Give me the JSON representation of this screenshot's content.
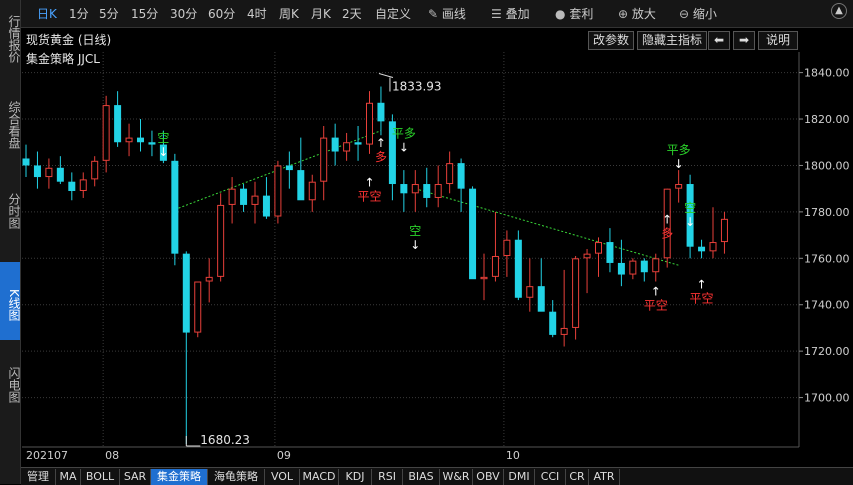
{
  "sidebar": {
    "items": [
      {
        "label": "行情报价",
        "active": false
      },
      {
        "label": "综合看盘",
        "active": false
      },
      {
        "label": "分时图",
        "active": false
      },
      {
        "label": "K线图",
        "active": true
      },
      {
        "label": "闪电图",
        "active": false
      }
    ]
  },
  "toolbar": {
    "periods": [
      "日K",
      "1分",
      "5分",
      "15分",
      "30分",
      "60分",
      "4时",
      "周K",
      "月K",
      "2天",
      "自定义"
    ],
    "active_period": "日K",
    "tools": [
      {
        "label": "画线",
        "icon": "pencil-icon"
      },
      {
        "label": "叠加",
        "icon": "layers-icon"
      },
      {
        "label": "套利",
        "icon": "moneybag-icon"
      },
      {
        "label": "放大",
        "icon": "zoom-in-icon"
      },
      {
        "label": "缩小",
        "icon": "zoom-out-icon"
      }
    ]
  },
  "chart_header": {
    "title": "现货黄金 (日线)",
    "strategy": "集金策略 JJCL"
  },
  "header_buttons": {
    "modify_params": "改参数",
    "hide_main_indicator": "隐藏主指标",
    "help": "说明"
  },
  "bottom_tabs": [
    "管理",
    "MA",
    "BOLL",
    "SAR",
    "集金策略",
    "海龟策略",
    "VOL",
    "MACD",
    "KDJ",
    "RSI",
    "BIAS",
    "W&R",
    "OBV",
    "DMI",
    "CCI",
    "CR",
    "ATR"
  ],
  "active_tab": "集金策略",
  "colors": {
    "up": "#e8403a",
    "down": "#22d3e6",
    "signal_green": "#2bd32b",
    "signal_red": "#ff3333",
    "trend_line": "#39d839",
    "accent": "#1f6fd0"
  },
  "chart_data": {
    "type": "candlestick",
    "y_axis": {
      "min": 1680,
      "max": 1845,
      "ticks": [
        1700,
        1720,
        1740,
        1760,
        1780,
        1800,
        1820,
        1840
      ]
    },
    "x_labels": [
      {
        "label": "202107",
        "index": 0
      },
      {
        "label": "08",
        "index": 7
      },
      {
        "label": "09",
        "index": 22
      },
      {
        "label": "10",
        "index": 42
      }
    ],
    "candles": [
      [
        1803,
        1809,
        1795,
        1800
      ],
      [
        1800,
        1806,
        1790,
        1795
      ],
      [
        1795,
        1803,
        1790,
        1799
      ],
      [
        1799,
        1804,
        1792,
        1793
      ],
      [
        1793,
        1797,
        1785,
        1789
      ],
      [
        1789,
        1797,
        1786,
        1794
      ],
      [
        1794,
        1804,
        1791,
        1802
      ],
      [
        1802,
        1830,
        1797,
        1826
      ],
      [
        1826,
        1832,
        1808,
        1810
      ],
      [
        1810,
        1818,
        1804,
        1812
      ],
      [
        1812,
        1820,
        1806,
        1810
      ],
      [
        1810,
        1815,
        1804,
        1809
      ],
      [
        1809,
        1815,
        1801,
        1802
      ],
      [
        1802,
        1805,
        1757,
        1762
      ],
      [
        1762,
        1763,
        1680,
        1728
      ],
      [
        1728,
        1749,
        1726,
        1750
      ],
      [
        1750,
        1760,
        1741,
        1752
      ],
      [
        1752,
        1788,
        1750,
        1783
      ],
      [
        1783,
        1795,
        1775,
        1790
      ],
      [
        1790,
        1792,
        1780,
        1783
      ],
      [
        1783,
        1793,
        1775,
        1787
      ],
      [
        1787,
        1795,
        1777,
        1778
      ],
      [
        1778,
        1802,
        1775,
        1800
      ],
      [
        1800,
        1806,
        1790,
        1798
      ],
      [
        1798,
        1812,
        1794,
        1785
      ],
      [
        1785,
        1796,
        1780,
        1793
      ],
      [
        1793,
        1817,
        1785,
        1812
      ],
      [
        1812,
        1818,
        1800,
        1806
      ],
      [
        1806,
        1814,
        1802,
        1810
      ],
      [
        1810,
        1817,
        1802,
        1809
      ],
      [
        1809,
        1832,
        1805,
        1827
      ],
      [
        1827,
        1834,
        1813,
        1819
      ],
      [
        1819,
        1822,
        1785,
        1792
      ],
      [
        1792,
        1798,
        1780,
        1788
      ],
      [
        1788,
        1798,
        1780,
        1792
      ],
      [
        1792,
        1799,
        1782,
        1786
      ],
      [
        1786,
        1800,
        1782,
        1792
      ],
      [
        1792,
        1806,
        1788,
        1801
      ],
      [
        1801,
        1803,
        1780,
        1790
      ],
      [
        1790,
        1791,
        1752,
        1751
      ],
      [
        1751,
        1762,
        1742,
        1752
      ],
      [
        1752,
        1780,
        1750,
        1761
      ],
      [
        1761,
        1772,
        1752,
        1768
      ],
      [
        1768,
        1772,
        1742,
        1743
      ],
      [
        1743,
        1760,
        1737,
        1748
      ],
      [
        1748,
        1760,
        1740,
        1737
      ],
      [
        1737,
        1742,
        1726,
        1727
      ],
      [
        1727,
        1755,
        1722,
        1730
      ],
      [
        1730,
        1761,
        1725,
        1760
      ],
      [
        1760,
        1764,
        1745,
        1762
      ],
      [
        1762,
        1769,
        1752,
        1767
      ],
      [
        1767,
        1773,
        1754,
        1758
      ],
      [
        1758,
        1768,
        1748,
        1753
      ],
      [
        1753,
        1760,
        1751,
        1759
      ],
      [
        1759,
        1760,
        1750,
        1754
      ],
      [
        1754,
        1762,
        1750,
        1760
      ],
      [
        1760,
        1790,
        1756,
        1790
      ],
      [
        1790,
        1798,
        1784,
        1792
      ],
      [
        1792,
        1796,
        1760,
        1765
      ],
      [
        1765,
        1768,
        1760,
        1763
      ],
      [
        1763,
        1782,
        1760,
        1767
      ],
      [
        1767,
        1780,
        1762,
        1777
      ]
    ],
    "trend_lines": [
      {
        "from": [
          13,
          1781
        ],
        "to": [
          31,
          1815
        ]
      },
      {
        "from": [
          34,
          1790
        ],
        "to": [
          57,
          1757
        ]
      }
    ],
    "annotations": [
      {
        "text": "1833.93",
        "index": 31,
        "value": 1834,
        "kind": "high"
      },
      {
        "text": "1680.23",
        "index": 14,
        "value": 1680,
        "kind": "low"
      }
    ],
    "signals": [
      {
        "text": "空",
        "index": 12,
        "value": 1810,
        "color": "green",
        "arrow": "down"
      },
      {
        "text": "多",
        "index": 31,
        "value": 1808,
        "color": "red",
        "arrow": "up"
      },
      {
        "text": "平空",
        "index": 30,
        "value": 1791,
        "color": "red",
        "arrow": "up"
      },
      {
        "text": "平多",
        "index": 33,
        "value": 1812,
        "color": "green",
        "arrow": "down"
      },
      {
        "text": "空",
        "index": 34,
        "value": 1770,
        "color": "green",
        "arrow": "down"
      },
      {
        "text": "平空",
        "index": 55,
        "value": 1744,
        "color": "red",
        "arrow": "up"
      },
      {
        "text": "平多",
        "index": 57,
        "value": 1805,
        "color": "green",
        "arrow": "down"
      },
      {
        "text": "多",
        "index": 56,
        "value": 1775,
        "color": "red",
        "arrow": "up"
      },
      {
        "text": "空",
        "index": 58,
        "value": 1780,
        "color": "green",
        "arrow": "down"
      },
      {
        "text": "平空",
        "index": 59,
        "value": 1747,
        "color": "red",
        "arrow": "up"
      }
    ]
  }
}
